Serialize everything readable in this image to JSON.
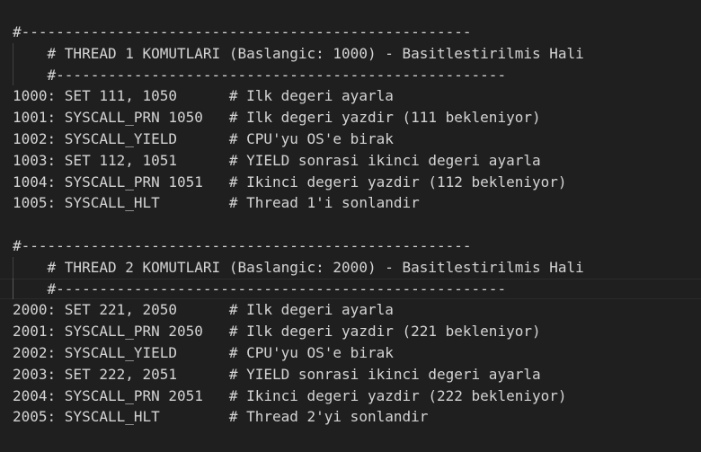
{
  "editor": {
    "lines": [
      {
        "indent": 0,
        "text": "#----------------------------------------------------"
      },
      {
        "indent": 1,
        "text": "    # THREAD 1 KOMUTLARI (Baslangic: 1000) - Basitlestirilmis Hali"
      },
      {
        "indent": 1,
        "text": "    #----------------------------------------------------"
      },
      {
        "indent": 0,
        "text": "1000: SET 111, 1050      # Ilk degeri ayarla"
      },
      {
        "indent": 0,
        "text": "1001: SYSCALL_PRN 1050   # Ilk degeri yazdir (111 bekleniyor)"
      },
      {
        "indent": 0,
        "text": "1002: SYSCALL_YIELD      # CPU'yu OS'e birak"
      },
      {
        "indent": 0,
        "text": "1003: SET 112, 1051      # YIELD sonrasi ikinci degeri ayarla"
      },
      {
        "indent": 0,
        "text": "1004: SYSCALL_PRN 1051   # Ikinci degeri yazdir (112 bekleniyor)"
      },
      {
        "indent": 0,
        "text": "1005: SYSCALL_HLT        # Thread 1'i sonlandir"
      },
      {
        "indent": 0,
        "text": ""
      },
      {
        "indent": 0,
        "text": "#----------------------------------------------------"
      },
      {
        "indent": 1,
        "text": "    # THREAD 2 KOMUTLARI (Baslangic: 2000) - Basitlestirilmis Hali"
      },
      {
        "indent": 1,
        "text": "    #----------------------------------------------------",
        "current": true
      },
      {
        "indent": 0,
        "text": "2000: SET 221, 2050      # Ilk degeri ayarla"
      },
      {
        "indent": 0,
        "text": "2001: SYSCALL_PRN 2050   # Ilk degeri yazdir (221 bekleniyor)"
      },
      {
        "indent": 0,
        "text": "2002: SYSCALL_YIELD      # CPU'yu OS'e birak"
      },
      {
        "indent": 0,
        "text": "2003: SET 222, 2051      # YIELD sonrasi ikinci degeri ayarla"
      },
      {
        "indent": 0,
        "text": "2004: SYSCALL_PRN 2051   # Ikinci degeri yazdir (222 bekleniyor)"
      },
      {
        "indent": 0,
        "text": "2005: SYSCALL_HLT        # Thread 2'yi sonlandir"
      }
    ]
  }
}
